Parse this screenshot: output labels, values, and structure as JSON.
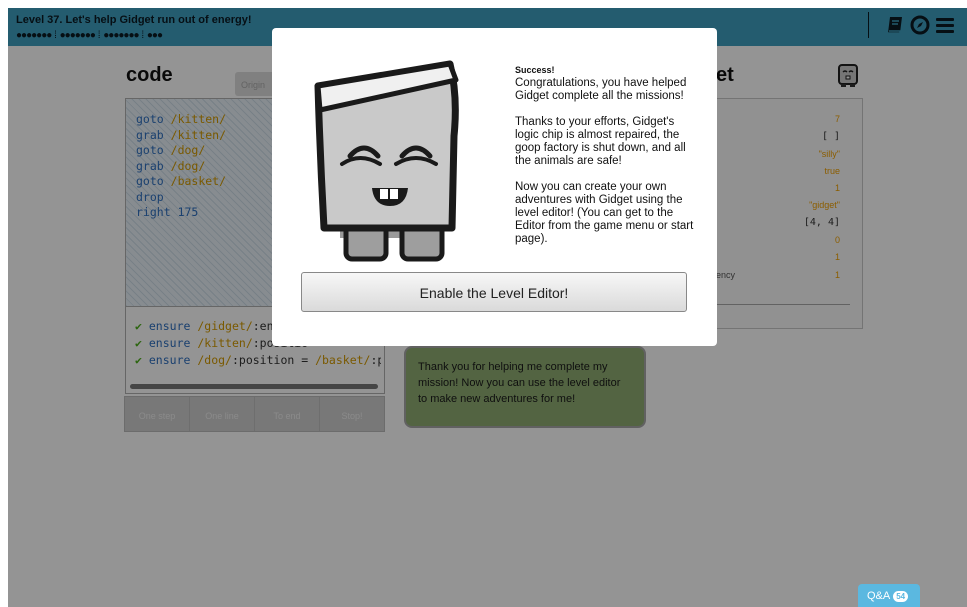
{
  "header": {
    "title": "Level 37. Let's help Gidget run out of energy!",
    "progress_dots": [
      "●●●●●●●",
      "●●●●●●●",
      "●●●●●●●",
      "●●●"
    ],
    "progress_sep": "⁞",
    "icons": [
      "book-icon",
      "compass-icon",
      "menu-icon"
    ]
  },
  "code_panel": {
    "title": "code",
    "original_button": "Origin",
    "lines": [
      {
        "kw": "goto",
        "arg": "/kitten/"
      },
      {
        "kw": "grab",
        "arg": "/kitten/"
      },
      {
        "kw": "goto",
        "arg": "/dog/"
      },
      {
        "kw": "grab",
        "arg": "/dog/"
      },
      {
        "kw": "goto",
        "arg": "/basket/"
      },
      {
        "kw": "drop",
        "arg": ""
      },
      {
        "kw": "right",
        "arg": "175"
      }
    ],
    "ensures": [
      {
        "check": "✔",
        "kw": "ensure",
        "obj": "/gidget/",
        "rest": ":energ"
      },
      {
        "check": "✔",
        "kw": "ensure",
        "obj": "/kitten/",
        "rest": ":positio"
      },
      {
        "check": "✔",
        "kw": "ensure",
        "obj": "/dog/",
        "rest": ":position = ",
        "obj2": "/basket/",
        "rest2": ":position"
      }
    ],
    "controls": [
      "One step",
      "One line",
      "To end",
      "Stop!"
    ]
  },
  "right_panel": {
    "title": "et",
    "values": [
      "7",
      "[ ]",
      "\"silly\"",
      "true",
      "1",
      "\"gidget\"",
      "[4, 4]",
      "0",
      "1",
      "1"
    ],
    "last_label": "ency"
  },
  "bubble": {
    "text": "Thank you for helping me complete my mission! Now you can use the level editor to make new adventures for me!"
  },
  "modal": {
    "success_label": "Success!",
    "para1": "Congratulations, you have helped Gidget complete all the missions!",
    "para2": "Thanks to your efforts, Gidget's logic chip is almost repaired, the goop factory is shut down, and all the animals are safe!",
    "para3": "Now you can create your own adventures with Gidget using the level editor! (You can get to the Editor from the game menu or start page).",
    "button": "Enable the Level Editor!"
  },
  "qa": {
    "label": "Q&A",
    "count": "54"
  }
}
